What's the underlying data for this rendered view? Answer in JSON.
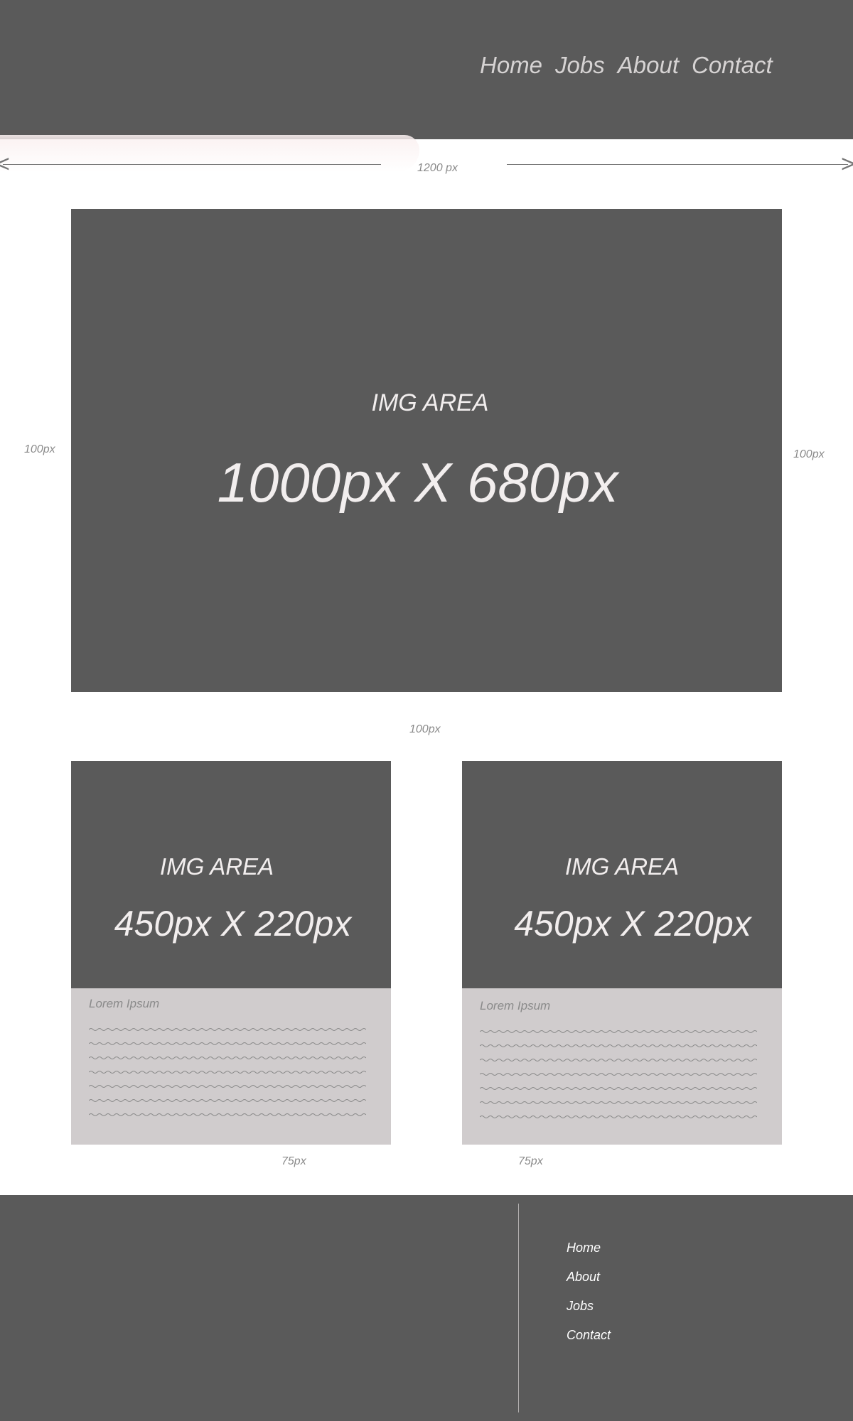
{
  "header": {
    "nav": [
      "Home",
      "Jobs",
      "About",
      "Contact"
    ]
  },
  "annotations": {
    "page_width": "1200 px",
    "left_margin": "100px",
    "right_margin": "100px",
    "hero_gap": "100px",
    "card_left_gap": "75px",
    "card_right_gap": "75px"
  },
  "hero": {
    "label": "IMG AREA",
    "size": "1000px X 680px"
  },
  "cards": [
    {
      "label": "IMG AREA",
      "size": "450px X 220px",
      "title": "Lorem Ipsum"
    },
    {
      "label": "IMG AREA",
      "size": "450px X 220px",
      "title": "Lorem Ipsum"
    }
  ],
  "footer": {
    "nav": [
      "Home",
      "About",
      "Jobs",
      "Contact"
    ]
  },
  "colors": {
    "block": "#5a5a5a",
    "card_body": "#d0cccd",
    "annotation": "#8a8a8a"
  }
}
